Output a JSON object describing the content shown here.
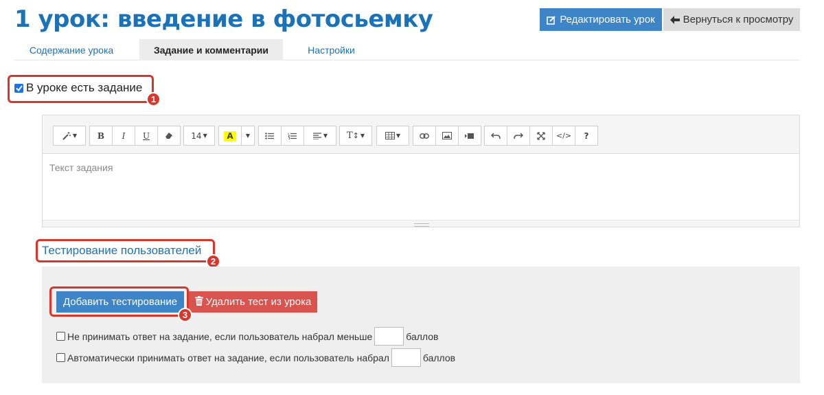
{
  "header": {
    "title": "1 урок: введение в фотосьемку",
    "edit_button": "Редактировать урок",
    "back_button": "Вернуться к просмотру"
  },
  "tabs": [
    {
      "label": "Содержание урока",
      "active": false
    },
    {
      "label": "Задание и комментарии",
      "active": true
    },
    {
      "label": "Настройки",
      "active": false
    }
  ],
  "task": {
    "has_task_label": "В уроке есть задание",
    "has_task_checked": true,
    "editor_placeholder": "Текст задания",
    "font_size": "14"
  },
  "toolbar_icons": [
    "magic-wand-icon",
    "bold-icon",
    "italic-icon",
    "underline-icon",
    "eraser-icon",
    "font-size-select",
    "highlight-color-icon",
    "color-dropdown",
    "bullet-list-icon",
    "numbered-list-icon",
    "align-icon",
    "text-height-icon",
    "table-icon",
    "link-icon",
    "image-icon",
    "video-icon",
    "undo-icon",
    "redo-icon",
    "fullscreen-icon",
    "code-view-icon",
    "help-icon"
  ],
  "testing": {
    "section_title": "Тестирование пользователей",
    "add_button": "Добавить тестирование",
    "delete_button": "Удалить тест из урока",
    "option1_label": "Не принимать ответ на задание, если пользователь набрал меньше",
    "option1_suffix": "баллов",
    "option1_checked": false,
    "option1_value": "",
    "option2_label": "Автоматически принимать ответ на задание, если пользователь набрал",
    "option2_suffix": "баллов",
    "option2_checked": false,
    "option2_value": ""
  },
  "annotations": [
    "1",
    "2",
    "3"
  ],
  "colors": {
    "primary": "#3d85c6",
    "title_blue": "#1a73b8",
    "danger": "#d9534f",
    "annotation_red": "#d9362b"
  }
}
